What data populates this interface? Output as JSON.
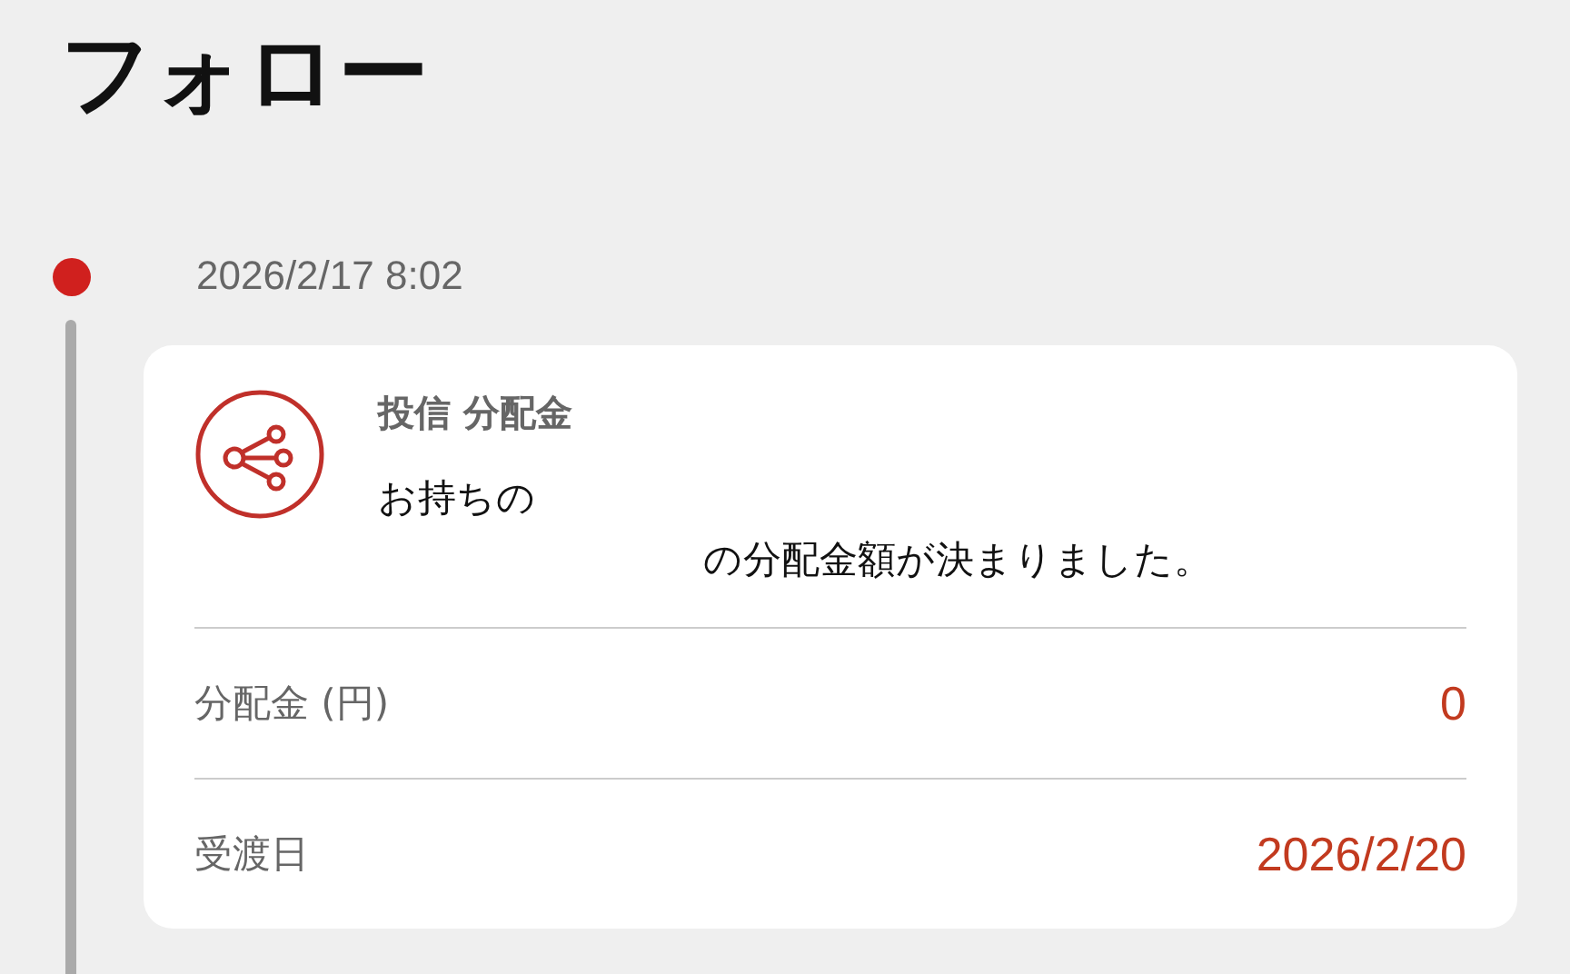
{
  "title": "フォロー",
  "timeline": [
    {
      "timestamp": "2026/2/17 8:02",
      "card": {
        "category": "投信 分配金",
        "message_lines": [
          "お持ちの",
          "の分配金額が決まりました。"
        ],
        "rows": [
          {
            "label": "分配金 (円)",
            "value": "0"
          },
          {
            "label": "受渡日",
            "value": "2026/2/20"
          }
        ]
      }
    }
  ]
}
